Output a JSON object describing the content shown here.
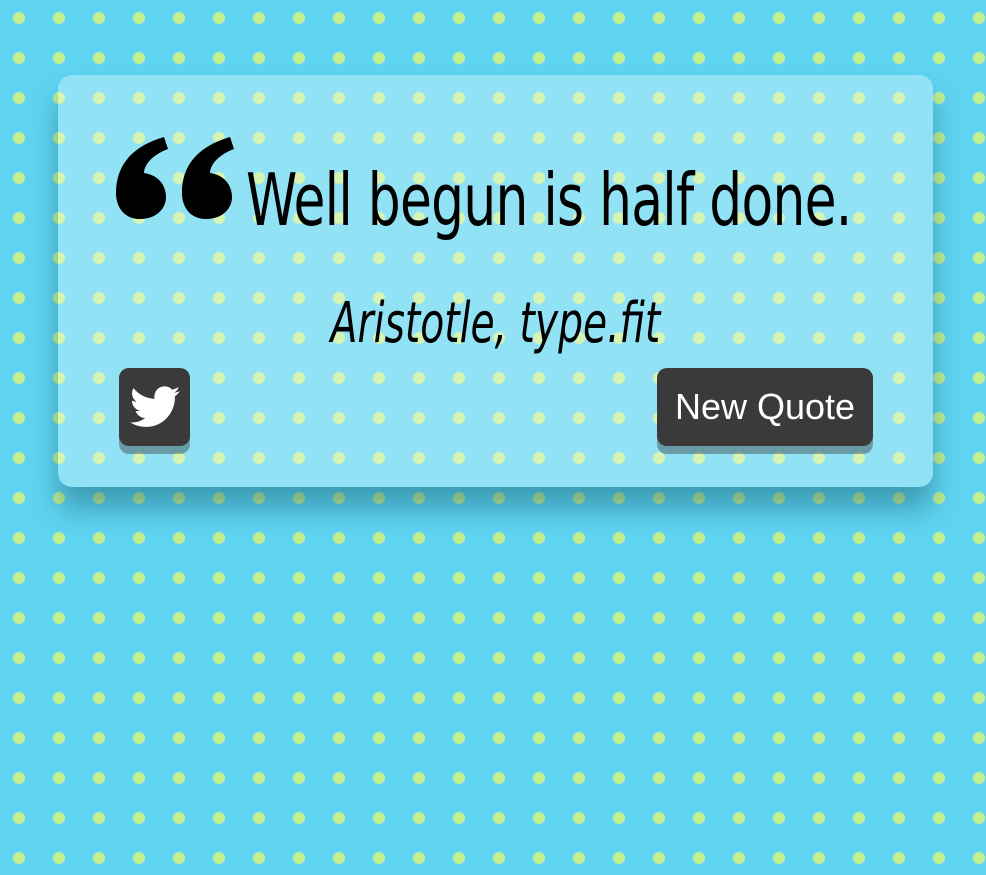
{
  "quote": {
    "text": "Well begun is half done.",
    "author": "Aristotle, type.fit"
  },
  "actions": {
    "tweet_icon": "twitter-icon",
    "new_quote_label": "New Quote"
  },
  "colors": {
    "background": "#5fd4f0",
    "dots": "#c4ef8e",
    "button": "#3a3a3a",
    "button_text": "#ffffff",
    "text": "#000000"
  }
}
